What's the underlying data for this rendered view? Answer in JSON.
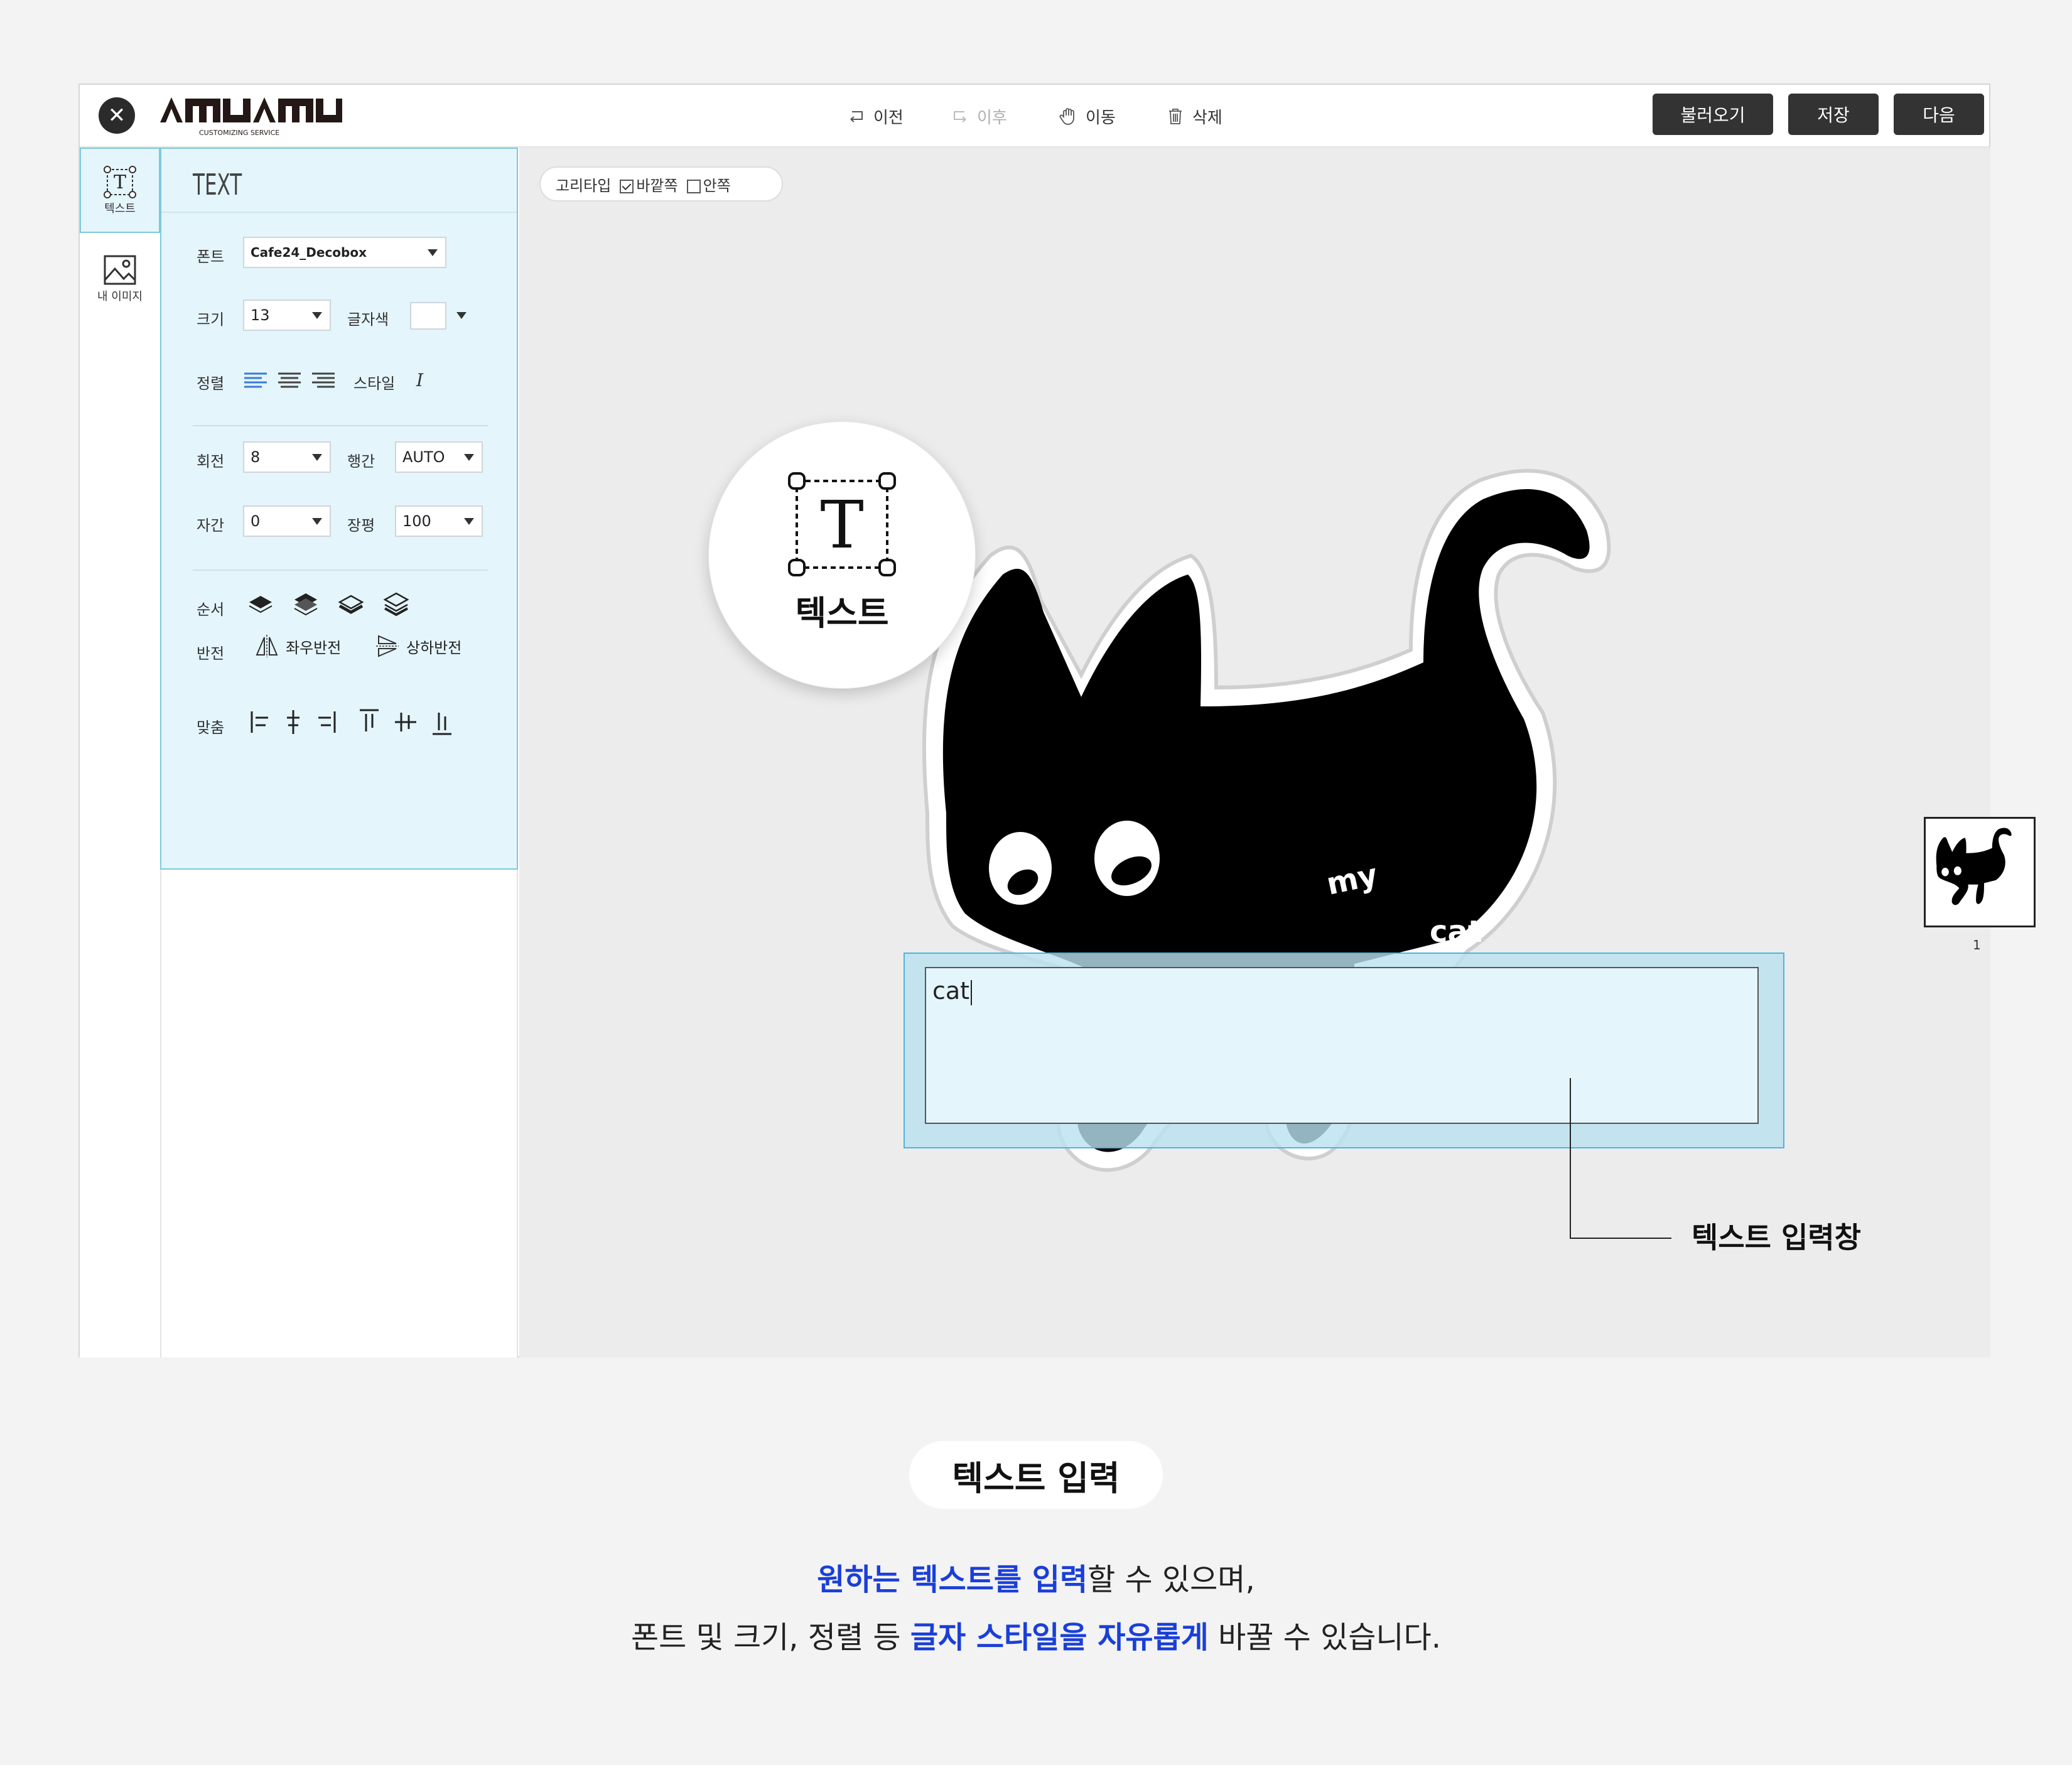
{
  "topbar": {
    "logo_text": "AMUAMU",
    "logo_sub": "CUSTOMIZING SERVICE",
    "tools": {
      "undo": "이전",
      "redo": "이후",
      "move": "이동",
      "delete": "삭제"
    },
    "buttons": {
      "load": "불러오기",
      "save": "저장",
      "next": "다음"
    }
  },
  "sidebar": {
    "tabs": [
      {
        "label": "텍스트",
        "icon": "text-icon"
      },
      {
        "label": "내 이미지",
        "icon": "image-icon"
      }
    ]
  },
  "text_panel": {
    "title": "TEXT",
    "font_label": "폰트",
    "font_value": "Cafe24_Decobox",
    "size_label": "크기",
    "size_value": "13",
    "color_label": "글자색",
    "color_value": "#ffffff",
    "align_label": "정렬",
    "style_label": "스타일",
    "style_italic": "I",
    "rotate_label": "회전",
    "rotate_value": "8",
    "line_label": "행간",
    "line_value": "AUTO",
    "spacing_label": "자간",
    "spacing_value": "0",
    "width_label": "장평",
    "width_value": "100",
    "order_label": "순서",
    "flip_label": "반전",
    "flip_h": "좌우반전",
    "flip_v": "상하반전",
    "fit_label": "맞춤"
  },
  "canvas": {
    "options": {
      "loop_type": "고리타입",
      "outside": "바깥쪽",
      "outside_checked": true,
      "inside": "안쪽",
      "inside_checked": false
    },
    "sticker_text_1": "my",
    "sticker_text_2": "cat",
    "input_value": "cat",
    "page_number": "1",
    "circle_label": "텍스트",
    "callout_label": "텍스트 입력창"
  },
  "caption": {
    "title": "텍스트 입력",
    "line1_hl": "원하는 텍스트를 입력",
    "line1_rest": "할 수 있으며,",
    "line2_pre": "폰트 및 크기, 정렬 등 ",
    "line2_hl": "글자 스타일을 자유롭게",
    "line2_post": " 바꿀 수 있습니다."
  },
  "colors": {
    "accent_blue": "#1a3fd8",
    "panel_bg": "#e4f5fc",
    "button_dark": "#333333"
  }
}
